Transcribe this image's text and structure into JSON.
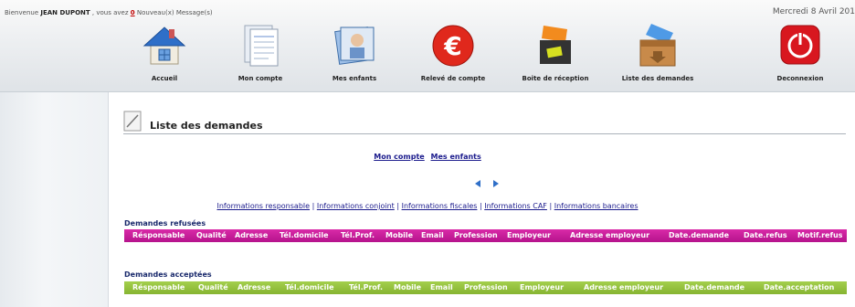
{
  "header": {
    "welcome_prefix": "Bienvenue",
    "user_name": "JEAN DUPONT",
    "welcome_mid": ", vous avez",
    "message_count": "0",
    "message_text": "Nouveau(x) Message(s)",
    "date": "Mercredi 8 Avril 201"
  },
  "nav": {
    "items": [
      {
        "label": "Accueil",
        "icon": "house-icon"
      },
      {
        "label": "Mon compte",
        "icon": "document-icon"
      },
      {
        "label": "Mes enfants",
        "icon": "photo-icon"
      },
      {
        "label": "Relevé de compte",
        "icon": "euro-icon"
      },
      {
        "label": "Boite de réception",
        "icon": "inbox-icon"
      },
      {
        "label": "Liste des demandes",
        "icon": "box-icon"
      },
      {
        "label": "Deconnexion",
        "icon": "power-icon"
      }
    ]
  },
  "page": {
    "title": "Liste des demandes",
    "top_links": [
      "Mon compte",
      "Mes enfants"
    ],
    "info_links": [
      "Informations responsable",
      "Informations conjoint",
      "Informations fiscales",
      "Informations CAF",
      "Informations bancaires"
    ],
    "separator": "|"
  },
  "refused": {
    "title": "Demandes refusées",
    "columns": [
      "Résponsable",
      "Qualité",
      "Adresse",
      "Tél.domicile",
      "Tél.Prof.",
      "Mobile",
      "Email",
      "Profession",
      "Employeur",
      "Adresse employeur",
      "Date.demande",
      "Date.refus",
      "Motif.refus"
    ],
    "color": "#c51a9a"
  },
  "accepted": {
    "title": "Demandes acceptées",
    "columns": [
      "Résponsable",
      "Qualité",
      "Adresse",
      "Tél.domicile",
      "Tél.Prof.",
      "Mobile",
      "Email",
      "Profession",
      "Employeur",
      "Adresse employeur",
      "Date.demande",
      "Date.acceptation"
    ],
    "color": "#95c13e"
  }
}
